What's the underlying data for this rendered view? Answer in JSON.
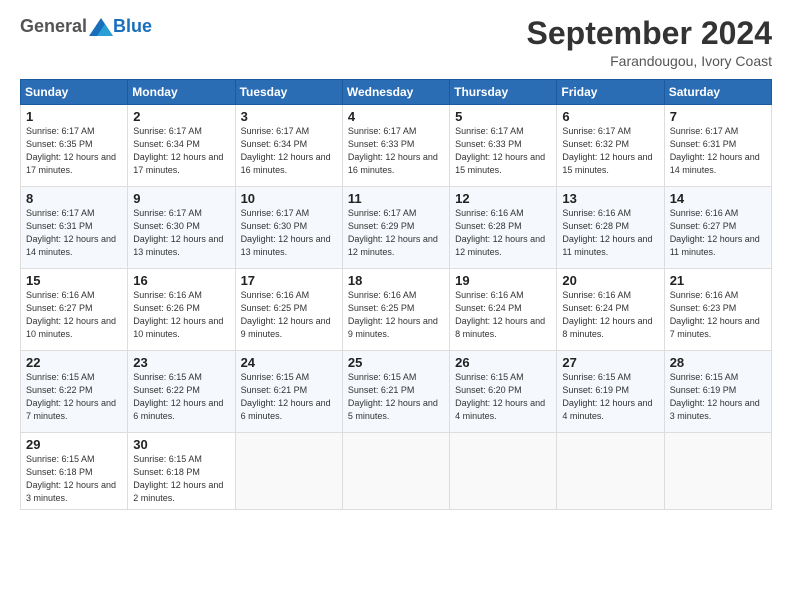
{
  "logo": {
    "general": "General",
    "blue": "Blue"
  },
  "header": {
    "month_year": "September 2024",
    "location": "Farandougou, Ivory Coast"
  },
  "weekdays": [
    "Sunday",
    "Monday",
    "Tuesday",
    "Wednesday",
    "Thursday",
    "Friday",
    "Saturday"
  ],
  "weeks": [
    [
      {
        "day": "1",
        "sunrise": "6:17 AM",
        "sunset": "6:35 PM",
        "daylight": "12 hours and 17 minutes."
      },
      {
        "day": "2",
        "sunrise": "6:17 AM",
        "sunset": "6:34 PM",
        "daylight": "12 hours and 17 minutes."
      },
      {
        "day": "3",
        "sunrise": "6:17 AM",
        "sunset": "6:34 PM",
        "daylight": "12 hours and 16 minutes."
      },
      {
        "day": "4",
        "sunrise": "6:17 AM",
        "sunset": "6:33 PM",
        "daylight": "12 hours and 16 minutes."
      },
      {
        "day": "5",
        "sunrise": "6:17 AM",
        "sunset": "6:33 PM",
        "daylight": "12 hours and 15 minutes."
      },
      {
        "day": "6",
        "sunrise": "6:17 AM",
        "sunset": "6:32 PM",
        "daylight": "12 hours and 15 minutes."
      },
      {
        "day": "7",
        "sunrise": "6:17 AM",
        "sunset": "6:31 PM",
        "daylight": "12 hours and 14 minutes."
      }
    ],
    [
      {
        "day": "8",
        "sunrise": "6:17 AM",
        "sunset": "6:31 PM",
        "daylight": "12 hours and 14 minutes."
      },
      {
        "day": "9",
        "sunrise": "6:17 AM",
        "sunset": "6:30 PM",
        "daylight": "12 hours and 13 minutes."
      },
      {
        "day": "10",
        "sunrise": "6:17 AM",
        "sunset": "6:30 PM",
        "daylight": "12 hours and 13 minutes."
      },
      {
        "day": "11",
        "sunrise": "6:17 AM",
        "sunset": "6:29 PM",
        "daylight": "12 hours and 12 minutes."
      },
      {
        "day": "12",
        "sunrise": "6:16 AM",
        "sunset": "6:28 PM",
        "daylight": "12 hours and 12 minutes."
      },
      {
        "day": "13",
        "sunrise": "6:16 AM",
        "sunset": "6:28 PM",
        "daylight": "12 hours and 11 minutes."
      },
      {
        "day": "14",
        "sunrise": "6:16 AM",
        "sunset": "6:27 PM",
        "daylight": "12 hours and 11 minutes."
      }
    ],
    [
      {
        "day": "15",
        "sunrise": "6:16 AM",
        "sunset": "6:27 PM",
        "daylight": "12 hours and 10 minutes."
      },
      {
        "day": "16",
        "sunrise": "6:16 AM",
        "sunset": "6:26 PM",
        "daylight": "12 hours and 10 minutes."
      },
      {
        "day": "17",
        "sunrise": "6:16 AM",
        "sunset": "6:25 PM",
        "daylight": "12 hours and 9 minutes."
      },
      {
        "day": "18",
        "sunrise": "6:16 AM",
        "sunset": "6:25 PM",
        "daylight": "12 hours and 9 minutes."
      },
      {
        "day": "19",
        "sunrise": "6:16 AM",
        "sunset": "6:24 PM",
        "daylight": "12 hours and 8 minutes."
      },
      {
        "day": "20",
        "sunrise": "6:16 AM",
        "sunset": "6:24 PM",
        "daylight": "12 hours and 8 minutes."
      },
      {
        "day": "21",
        "sunrise": "6:16 AM",
        "sunset": "6:23 PM",
        "daylight": "12 hours and 7 minutes."
      }
    ],
    [
      {
        "day": "22",
        "sunrise": "6:15 AM",
        "sunset": "6:22 PM",
        "daylight": "12 hours and 7 minutes."
      },
      {
        "day": "23",
        "sunrise": "6:15 AM",
        "sunset": "6:22 PM",
        "daylight": "12 hours and 6 minutes."
      },
      {
        "day": "24",
        "sunrise": "6:15 AM",
        "sunset": "6:21 PM",
        "daylight": "12 hours and 6 minutes."
      },
      {
        "day": "25",
        "sunrise": "6:15 AM",
        "sunset": "6:21 PM",
        "daylight": "12 hours and 5 minutes."
      },
      {
        "day": "26",
        "sunrise": "6:15 AM",
        "sunset": "6:20 PM",
        "daylight": "12 hours and 4 minutes."
      },
      {
        "day": "27",
        "sunrise": "6:15 AM",
        "sunset": "6:19 PM",
        "daylight": "12 hours and 4 minutes."
      },
      {
        "day": "28",
        "sunrise": "6:15 AM",
        "sunset": "6:19 PM",
        "daylight": "12 hours and 3 minutes."
      }
    ],
    [
      {
        "day": "29",
        "sunrise": "6:15 AM",
        "sunset": "6:18 PM",
        "daylight": "12 hours and 3 minutes."
      },
      {
        "day": "30",
        "sunrise": "6:15 AM",
        "sunset": "6:18 PM",
        "daylight": "12 hours and 2 minutes."
      },
      null,
      null,
      null,
      null,
      null
    ]
  ]
}
